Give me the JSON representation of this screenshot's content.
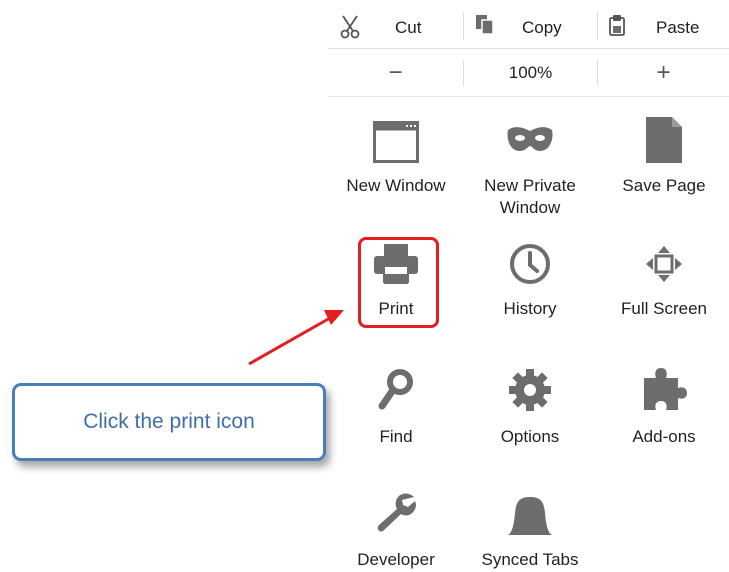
{
  "edit": {
    "cut_label": "Cut",
    "copy_label": "Copy",
    "paste_label": "Paste"
  },
  "zoom": {
    "minus": "−",
    "level": "100%",
    "plus": "+"
  },
  "items": {
    "new_window": "New Window",
    "new_private_window_line1": "New Private",
    "new_private_window_line2": "Window",
    "save_page": "Save Page",
    "print": "Print",
    "history": "History",
    "full_screen": "Full Screen",
    "find": "Find",
    "options": "Options",
    "addons": "Add-ons",
    "developer": "Developer",
    "synced_tabs": "Synced Tabs"
  },
  "callout": {
    "text": "Click the print icon"
  },
  "colors": {
    "icon_gray": "#6d6d6d",
    "highlight_red": "#e31e1e",
    "callout_border": "#4a7ebb",
    "callout_text": "#3f6fa8"
  }
}
